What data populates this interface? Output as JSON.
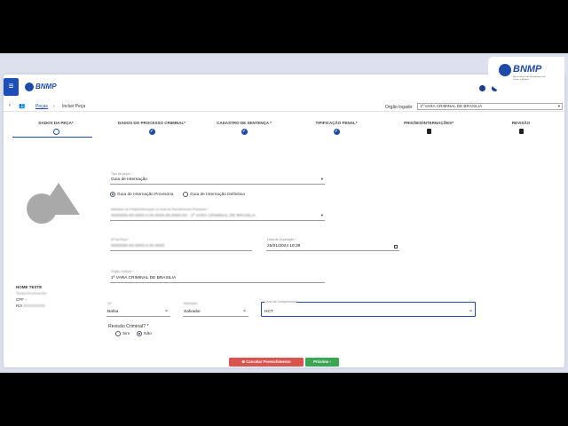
{
  "app": {
    "logo": "BNMP",
    "logo_subtitle": "Banco Nacional de Monitoramento de Prisões e Medidas"
  },
  "header": {
    "menu_icon": "menu-icon",
    "icons": [
      "info-icon",
      "user-icon",
      "settings-icon"
    ]
  },
  "breadcrumb": {
    "items": [
      "Peças",
      "Incluir Peça"
    ],
    "separator": "›"
  },
  "org": {
    "label": "Orgão logado:",
    "value": "1ª VARA CRIMINAL DE BRASILIA"
  },
  "steps": [
    {
      "label": "DADOS DA PEÇA*",
      "state": "active"
    },
    {
      "label": "DADOS DO PROCESSO CRIMINAL*",
      "state": "done"
    },
    {
      "label": "CADASTRO DE SENTENÇA *",
      "state": "done"
    },
    {
      "label": "TIPIFICAÇÃO PENAL*",
      "state": "done"
    },
    {
      "label": "PRISÕES/INTERNAÇÕES*",
      "state": "locked"
    },
    {
      "label": "REVISÃO",
      "state": "locked"
    }
  ],
  "person": {
    "name": "NOME TESTE",
    "alias": "TesteAlcunhaAbc",
    "cpf_label": "CPF -",
    "rji_label": "RJI",
    "rji_value": "0000000000"
  },
  "form": {
    "tipo_label": "Tipo da peça *",
    "tipo_value": "Guia de Internação",
    "radio_provisoria": "Guia de Internação Provisória",
    "radio_definitiva": "Guia de Internação Definitiva",
    "mandado_label": "Mandado de Prisão/Internação ou Guia de Recolhimento Provisório *",
    "mandado_value": "0000000-00.0000.0.00.0000.00.0000.00 - 1ª VARA CRIMINAL DE BRASILIA",
    "numero_label": "Nº da Peça *",
    "numero_value": "0000000-00.0000.0.00.0000",
    "data_label": "Data de Expedição *",
    "data_value": "25/01/2024 10:39",
    "orgao_label": "Órgão Judicial *",
    "orgao_value": "1ª VARA CRIMINAL DE BRASILIA",
    "uf_label": "UF",
    "uf_value": "Bahia",
    "municipio_label": "Município",
    "municipio_value": "Salvador",
    "local_label": "Local de Cumprimento",
    "local_value": "HCT",
    "revisao_label": "Revisão Criminal? *",
    "revisao_sim": "Sim",
    "revisao_nao": "Não"
  },
  "buttons": {
    "cancel": "Cancelar Preenchimento",
    "next": "Próximo"
  }
}
